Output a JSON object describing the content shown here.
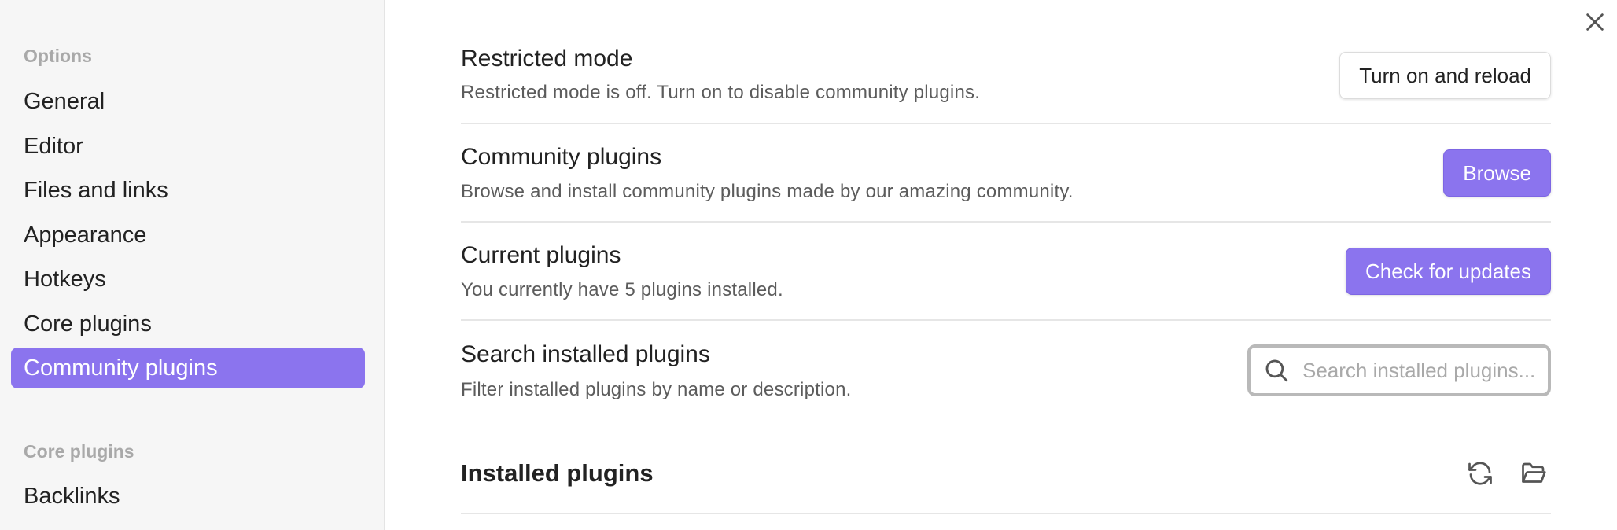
{
  "sidebar": {
    "options_heading": "Options",
    "options_items": [
      {
        "label": "General"
      },
      {
        "label": "Editor"
      },
      {
        "label": "Files and links"
      },
      {
        "label": "Appearance"
      },
      {
        "label": "Hotkeys"
      },
      {
        "label": "Core plugins"
      },
      {
        "label": "Community plugins",
        "active": true
      }
    ],
    "core_heading": "Core plugins",
    "core_items": [
      {
        "label": "Backlinks"
      }
    ]
  },
  "settings": {
    "restricted": {
      "name": "Restricted mode",
      "description": "Restricted mode is off. Turn on to disable community plugins.",
      "button": "Turn on and reload"
    },
    "community": {
      "name": "Community plugins",
      "description": "Browse and install community plugins made by our amazing community.",
      "button": "Browse"
    },
    "current": {
      "name": "Current plugins",
      "description": "You currently have 5 plugins installed.",
      "button": "Check for updates"
    },
    "search": {
      "name": "Search installed plugins",
      "description": "Filter installed plugins by name or description.",
      "placeholder": "Search installed plugins...",
      "value": ""
    }
  },
  "installed": {
    "title": "Installed plugins",
    "icons": [
      "reload-icon",
      "folder-open-icon"
    ]
  },
  "colors": {
    "accent": "#8b74ee",
    "sidebar_bg": "#f6f6f6",
    "muted_text": "#a9a9a9"
  }
}
